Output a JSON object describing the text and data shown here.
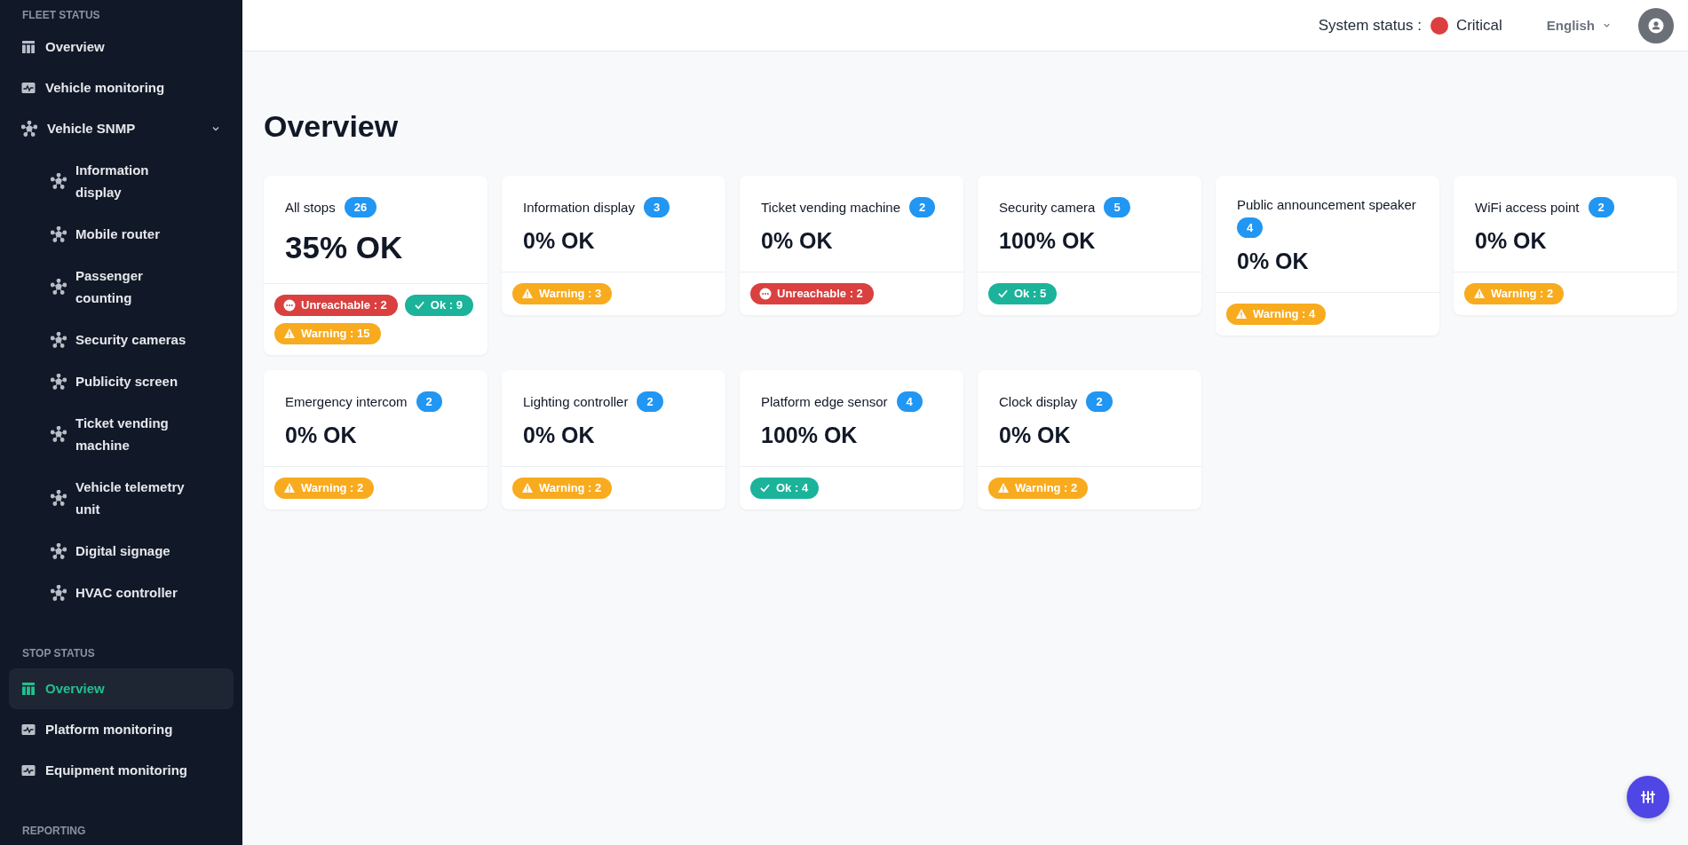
{
  "sidebar": {
    "sections": [
      {
        "heading": "FLEET STATUS",
        "items": [
          {
            "label": "Overview",
            "kind": "table",
            "selected": false
          },
          {
            "label": "Vehicle monitoring",
            "kind": "pulse",
            "selected": false
          },
          {
            "label": "Vehicle SNMP",
            "kind": "network",
            "selected": false,
            "expanded": true,
            "children": [
              {
                "label": "Information display",
                "kind": "network",
                "selected": false
              },
              {
                "label": "Mobile router",
                "kind": "network",
                "selected": false
              },
              {
                "label": "Passenger counting",
                "kind": "network",
                "selected": false
              },
              {
                "label": "Security cameras",
                "kind": "network",
                "selected": false
              },
              {
                "label": "Publicity screen",
                "kind": "network",
                "selected": false
              },
              {
                "label": "Ticket vending machine",
                "kind": "network",
                "selected": false
              },
              {
                "label": "Vehicle telemetry unit",
                "kind": "network",
                "selected": false
              },
              {
                "label": "Digital signage",
                "kind": "network",
                "selected": false
              },
              {
                "label": "HVAC controller",
                "kind": "network",
                "selected": false
              }
            ]
          }
        ]
      },
      {
        "heading": "STOP STATUS",
        "items": [
          {
            "label": "Overview",
            "kind": "table",
            "selected": true
          },
          {
            "label": "Platform monitoring",
            "kind": "pulse",
            "selected": false
          },
          {
            "label": "Equipment monitoring",
            "kind": "pulse",
            "selected": false
          }
        ]
      },
      {
        "heading": "REPORTING"
      }
    ]
  },
  "header": {
    "system_status": {
      "label": "System status :",
      "color": "#dc3f3f",
      "value": "Critical"
    },
    "language": "English"
  },
  "page_title": "Overview",
  "cards": [
    {
      "kind": "summary",
      "title": "All stops",
      "count": "26",
      "value": "35% OK",
      "statuses": [
        {
          "kind": "unreachable",
          "text": "Unreachable : 2"
        },
        {
          "kind": "ok",
          "text": "Ok : 9"
        },
        {
          "kind": "warning",
          "text": "Warning : 15"
        }
      ]
    },
    {
      "kind": "device",
      "title": "Information display",
      "count": "3",
      "value": "0% OK",
      "statuses": [
        {
          "kind": "warning",
          "text": "Warning : 3"
        }
      ]
    },
    {
      "kind": "device",
      "title": "Ticket vending machine",
      "count": "2",
      "value": "0% OK",
      "statuses": [
        {
          "kind": "unreachable",
          "text": "Unreachable : 2"
        }
      ]
    },
    {
      "kind": "device",
      "title": "Security camera",
      "count": "5",
      "value": "100% OK",
      "statuses": [
        {
          "kind": "ok",
          "text": "Ok : 5"
        }
      ]
    },
    {
      "kind": "device",
      "title": "Public announcement speaker",
      "count": "4",
      "value": "0% OK",
      "statuses": [
        {
          "kind": "warning",
          "text": "Warning : 4"
        }
      ]
    },
    {
      "kind": "device",
      "title": "WiFi access point",
      "count": "2",
      "value": "0% OK",
      "statuses": [
        {
          "kind": "warning",
          "text": "Warning : 2"
        }
      ]
    },
    {
      "kind": "device",
      "title": "Emergency intercom",
      "count": "2",
      "value": "0% OK",
      "statuses": [
        {
          "kind": "warning",
          "text": "Warning : 2"
        }
      ]
    },
    {
      "kind": "device",
      "title": "Lighting controller",
      "count": "2",
      "value": "0% OK",
      "statuses": [
        {
          "kind": "warning",
          "text": "Warning : 2"
        }
      ]
    },
    {
      "kind": "device",
      "title": "Platform edge sensor",
      "count": "4",
      "value": "100% OK",
      "statuses": [
        {
          "kind": "ok",
          "text": "Ok : 4"
        }
      ]
    },
    {
      "kind": "device",
      "title": "Clock display",
      "count": "2",
      "value": "0% OK",
      "statuses": [
        {
          "kind": "warning",
          "text": "Warning : 2"
        }
      ]
    }
  ]
}
